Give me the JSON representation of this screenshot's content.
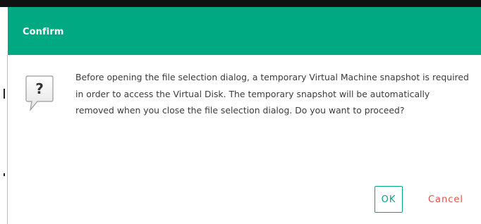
{
  "dialog": {
    "title": "Confirm",
    "icon": "question-speech-bubble-icon",
    "message": "Before opening the file selection dialog, a temporary Virtual Machine snapshot is required in order to access the Virtual Disk. The temporary snapshot will be automatically removed when you close the file selection dialog. Do you want to proceed?",
    "buttons": {
      "ok_label": "OK",
      "cancel_label": "Cancel"
    }
  },
  "colors": {
    "header": "#01A982",
    "ok": "#01A982",
    "cancel": "#E5524A",
    "text": "#3b3b3b"
  }
}
